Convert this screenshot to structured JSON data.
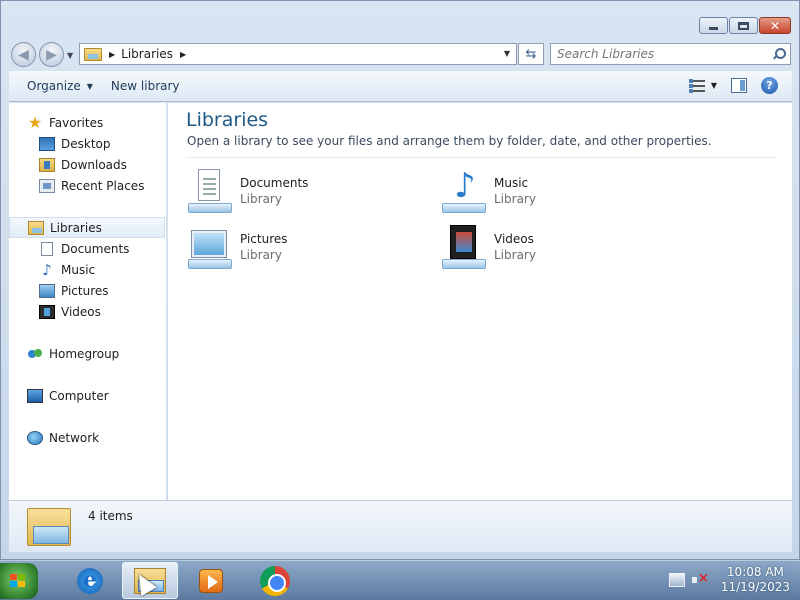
{
  "address": {
    "crumb": "Libraries",
    "search_placeholder": "Search Libraries"
  },
  "toolbar": {
    "organize_label": "Organize",
    "new_library_label": "New library"
  },
  "nav": {
    "favorites": "Favorites",
    "desktop": "Desktop",
    "downloads": "Downloads",
    "recent_places": "Recent Places",
    "libraries": "Libraries",
    "documents": "Documents",
    "music": "Music",
    "pictures": "Pictures",
    "videos": "Videos",
    "homegroup": "Homegroup",
    "computer": "Computer",
    "network": "Network"
  },
  "content": {
    "heading": "Libraries",
    "subheading": "Open a library to see your files and arrange them by folder, date, and other properties.",
    "libraries": [
      {
        "name": "Documents",
        "type": "Library",
        "icon": "documents-library-icon"
      },
      {
        "name": "Music",
        "type": "Library",
        "icon": "music-library-icon"
      },
      {
        "name": "Pictures",
        "type": "Library",
        "icon": "pictures-library-icon"
      },
      {
        "name": "Videos",
        "type": "Library",
        "icon": "videos-library-icon"
      }
    ]
  },
  "details": {
    "count_text": "4 items"
  },
  "taskbar": {
    "apps": [
      "internet-explorer",
      "windows-explorer",
      "windows-media-player",
      "google-chrome"
    ],
    "time": "10:08 AM",
    "date": "11/19/2023"
  },
  "colors": {
    "heading": "#1e5a87",
    "taskbar": "#5c7aa0",
    "selection": "#e3ecf7"
  }
}
